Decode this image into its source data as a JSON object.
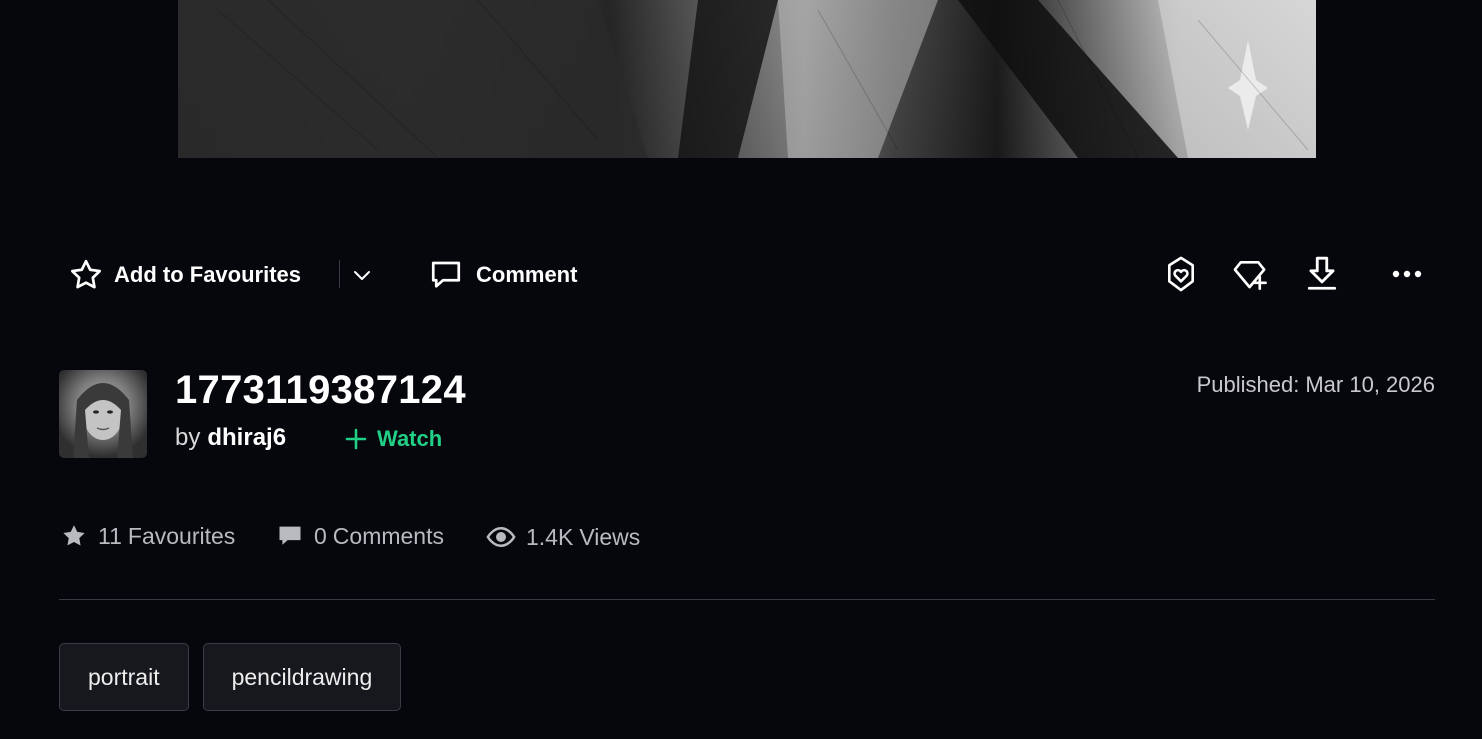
{
  "actions": {
    "add_to_favourites": "Add to Favourites",
    "comment": "Comment"
  },
  "deviation": {
    "title": "1773119387124",
    "by_label": "by",
    "author": "dhiraj6",
    "watch_label": "Watch",
    "published_label": "Published:",
    "published_date": "Mar 10, 2026"
  },
  "stats": {
    "favourites_count": "11",
    "favourites_label": "Favourites",
    "comments_count": "0",
    "comments_label": "Comments",
    "views_count": "1.4K",
    "views_label": "Views"
  },
  "tags": [
    "portrait",
    "pencildrawing"
  ],
  "colors": {
    "background": "#06070d",
    "accent_green": "#21d086",
    "text_primary": "#ffffff",
    "text_secondary": "#b9bac0"
  },
  "icons": {
    "favourite": "star-outline-icon",
    "dropdown": "chevron-down-icon",
    "comment": "speech-bubble-icon",
    "give": "heart-gem-icon",
    "add_to_collection": "gem-plus-icon",
    "download": "download-icon",
    "more": "more-horizontal-icon",
    "watch": "plus-icon"
  }
}
